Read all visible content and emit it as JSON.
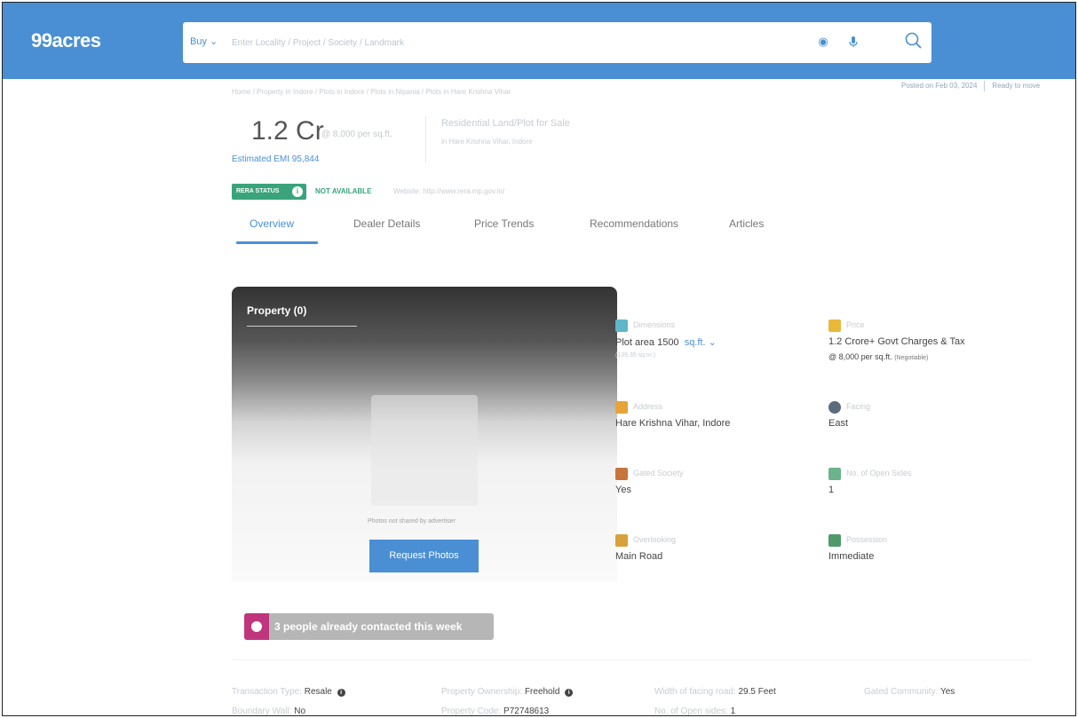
{
  "header": {
    "logo": "99acres",
    "buy_label": "Buy",
    "search_placeholder": "Enter Locality / Project / Society / Landmark"
  },
  "meta": {
    "breadcrumb": "Home / Property in Indore / Plots in Indore / Plots in Nipania / Plots in Hare Krishna Vihar",
    "posted": "Posted on Feb 03, 2024",
    "ready": "Ready to move"
  },
  "summary": {
    "price": "1.2 Cr",
    "rate": "@ 8,000 per sq.ft.",
    "emi": "Estimated EMI 95,844",
    "type": "Residential Land/Plot for Sale",
    "location": "in Hare Krishna Vihar, Indore"
  },
  "rera": {
    "badge": "RERA STATUS",
    "status": "NOT AVAILABLE",
    "website": "Website: http://www.rera.mp.gov.in/"
  },
  "tabs": [
    {
      "label": "Overview"
    },
    {
      "label": "Dealer Details"
    },
    {
      "label": "Price Trends"
    },
    {
      "label": "Recommendations"
    },
    {
      "label": "Articles"
    }
  ],
  "gallery": {
    "title": "Property (0)",
    "note": "Photos not shared by advertiser",
    "request_button": "Request Photos"
  },
  "details": {
    "dimensions": {
      "label": "Dimensions",
      "value": "Plot area 1500",
      "unit": "sq.ft.",
      "sub": "(139.35 sq.m.)"
    },
    "price": {
      "label": "Price",
      "value": "1.2 Crore+ Govt Charges & Tax",
      "sub": "@ 8,000 per sq.ft.",
      "sub_note": "(Negotiable)"
    },
    "address": {
      "label": "Address",
      "value": "Hare Krishna Vihar, Indore"
    },
    "facing": {
      "label": "Facing",
      "value": "East"
    },
    "gated": {
      "label": "Gated Society",
      "value": "Yes"
    },
    "open_sides": {
      "label": "No. of Open Sides",
      "value": "1"
    },
    "overlooking": {
      "label": "Overlooking",
      "value": "Main Road"
    },
    "possession": {
      "label": "Possession",
      "value": "Immediate"
    }
  },
  "contacted": {
    "text": "3 people already contacted this week"
  },
  "facts": {
    "transaction": {
      "label": "Transaction Type:",
      "value": "Resale"
    },
    "ownership": {
      "label": "Property Ownership:",
      "value": "Freehold"
    },
    "road_width": {
      "label": "Width of facing road:",
      "value": "29.5 Feet"
    },
    "gated_community": {
      "label": "Gated Community:",
      "value": "Yes"
    },
    "boundary": {
      "label": "Boundary Wall:",
      "value": "No"
    },
    "code": {
      "label": "Property Code:",
      "value": "P72748613"
    },
    "open_sides": {
      "label": "No. of Open sides:",
      "value": "1"
    }
  },
  "colors": {
    "brand_blue": "#4a8fd3",
    "rera_green": "#39a47b",
    "contact_magenta": "#c0367d"
  }
}
